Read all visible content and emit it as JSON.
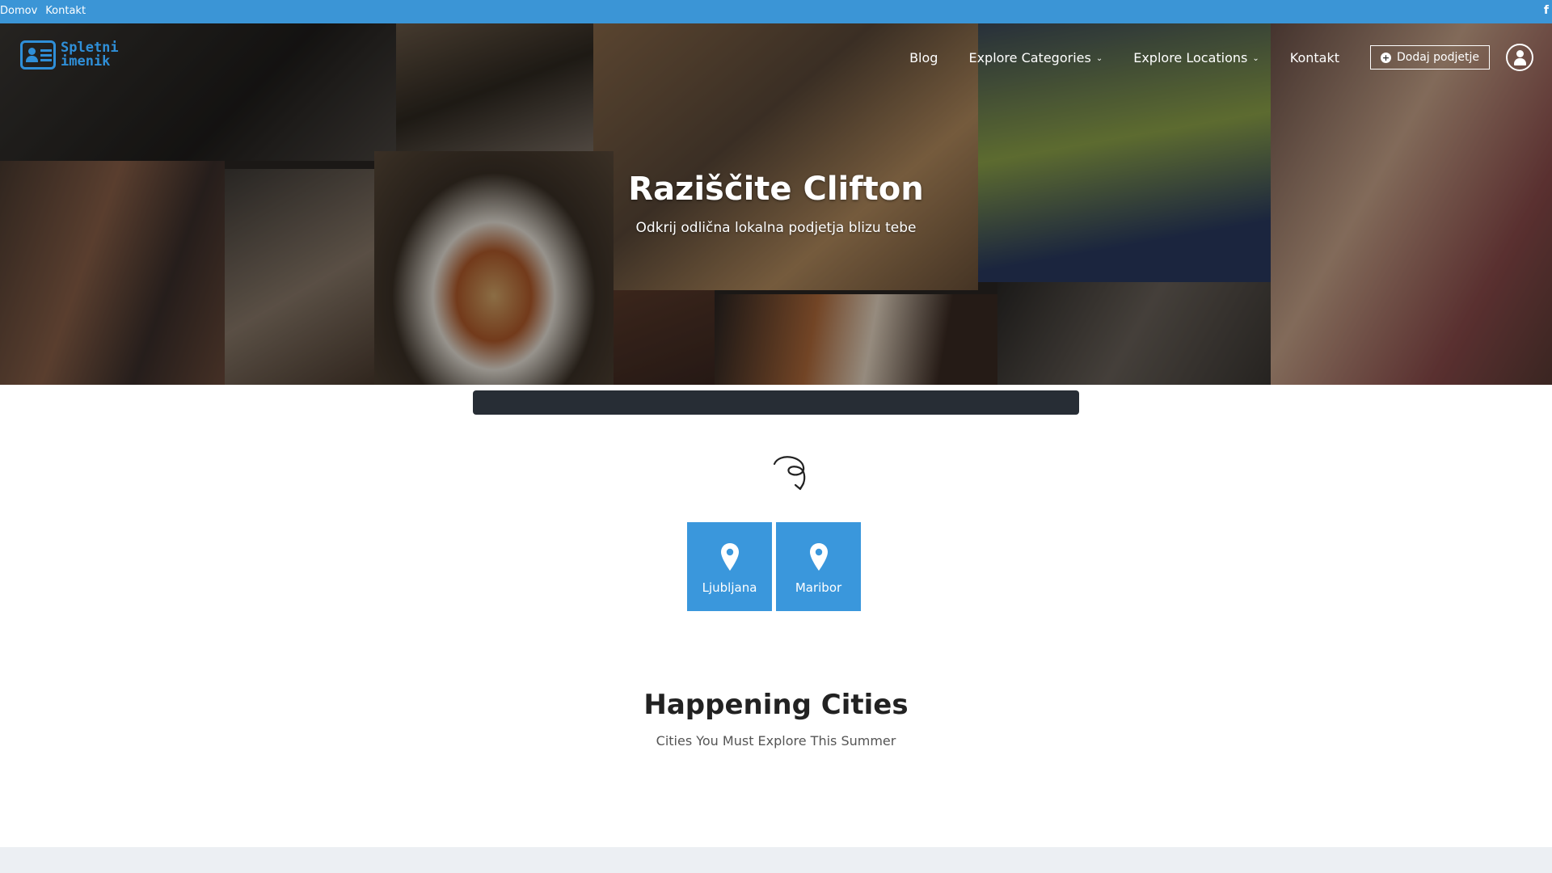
{
  "topbar": {
    "links": [
      "Domov",
      "Kontakt"
    ],
    "social_icon": "facebook-icon",
    "bg_color": "#3b95d6"
  },
  "logo": {
    "line1": "Spletni",
    "line2": "imenik",
    "color": "#2f8fd8"
  },
  "nav": {
    "items": [
      {
        "label": "Blog",
        "dropdown": false
      },
      {
        "label": "Explore Categories",
        "dropdown": true
      },
      {
        "label": "Explore Locations",
        "dropdown": true
      },
      {
        "label": "Kontakt",
        "dropdown": false
      }
    ],
    "add_button": "Dodaj podjetje",
    "user_icon": "user-icon"
  },
  "hero": {
    "title": "Raziščite Clifton",
    "subtitle": "Odkrij odlična lokalna podjetja blizu tebe"
  },
  "cities": [
    {
      "name": "Ljubljana",
      "icon": "map-pin-icon"
    },
    {
      "name": "Maribor",
      "icon": "map-pin-icon"
    }
  ],
  "city_card_color": "#3a97dc",
  "section": {
    "title": "Happening Cities",
    "subtitle": "Cities You Must Explore This Summer"
  }
}
